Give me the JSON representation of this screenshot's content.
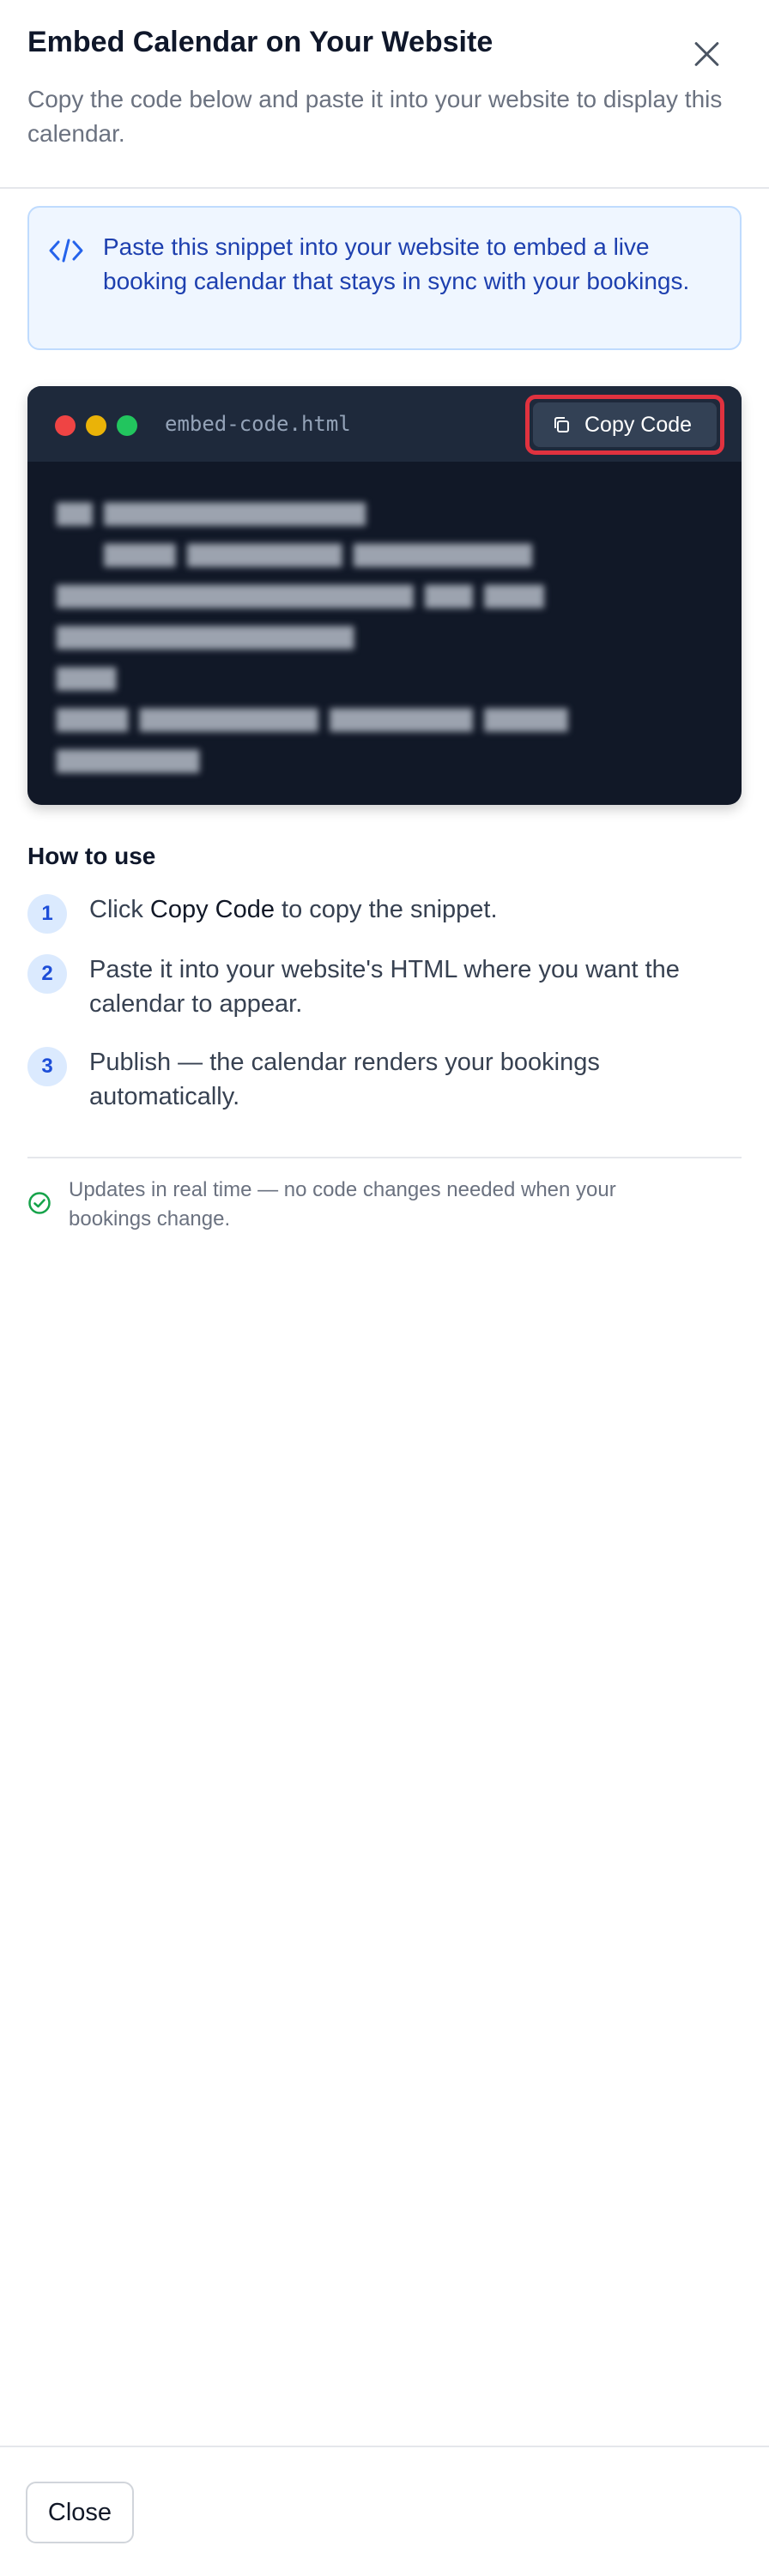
{
  "dialog": {
    "title": "Embed Calendar on Your Website",
    "subtitle": "Copy the code below and paste it into your website to display this calendar.",
    "close_icon": "close-icon"
  },
  "info": {
    "icon": "code-icon",
    "text": "Paste this snippet into your website to embed a live booking calendar that stays in sync with your bookings."
  },
  "code_window": {
    "filename": "embed-code.html",
    "copy_button_label": "Copy Code",
    "copy_icon": "copy-icon",
    "highlight_color": "#e0323f"
  },
  "how_to_use": {
    "title": "How to use",
    "steps": [
      {
        "number": "1",
        "pre": "Click ",
        "bold": "Copy Code",
        "post": " to copy the snippet."
      },
      {
        "number": "2",
        "pre": "Paste it into your website's HTML where you want the calendar to appear.",
        "bold": "",
        "post": ""
      },
      {
        "number": "3",
        "pre": "Publish — the calendar renders your bookings automatically.",
        "bold": "",
        "post": ""
      }
    ]
  },
  "note": {
    "icon": "check-circle-icon",
    "text": "Updates in real time — no code changes needed when your bookings change."
  },
  "footer": {
    "close_label": "Close"
  },
  "colors": {
    "accent": "#1d4ed8",
    "info_bg": "#eff6ff",
    "code_bg": "#111827",
    "success": "#16a34a"
  }
}
